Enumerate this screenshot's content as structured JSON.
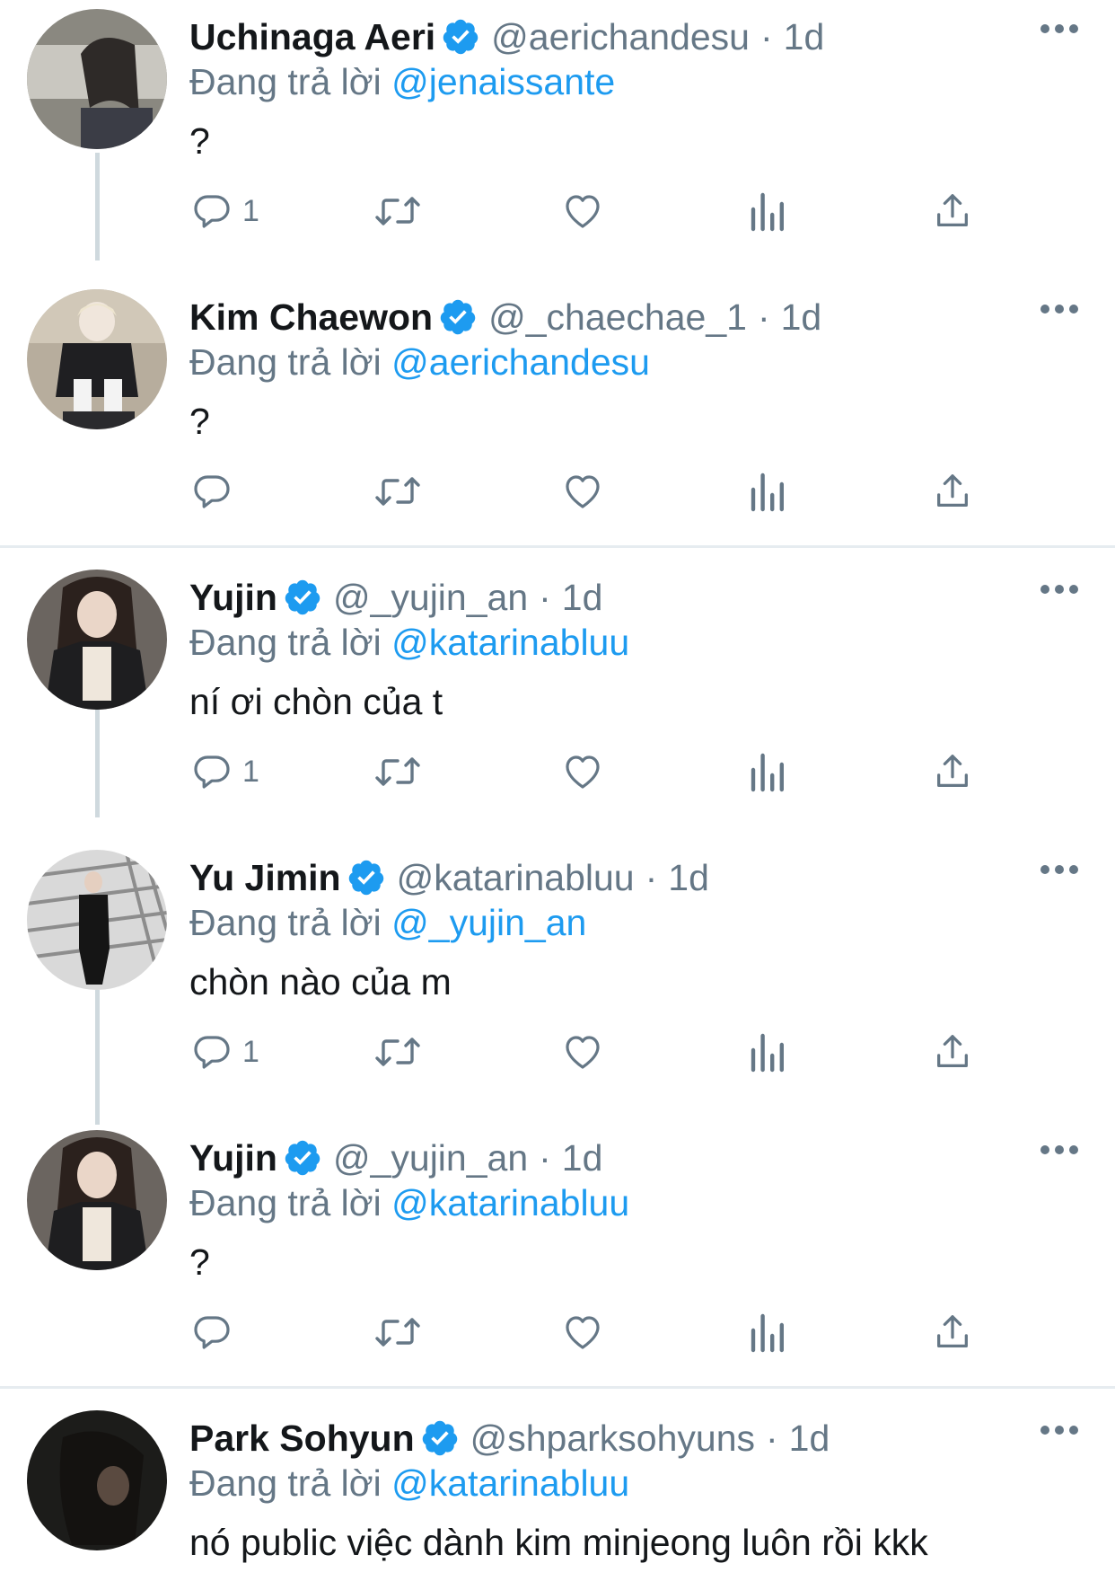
{
  "reply_prefix": "Đang trả lời",
  "colors": {
    "accent": "#1d9bf0",
    "muted": "#657786",
    "text": "#14171a",
    "divider": "#e6ecf0",
    "thread": "#cfd9de"
  },
  "icons": {
    "reply": "reply-bubble-icon",
    "retweet": "retweet-icon",
    "like": "heart-icon",
    "analytics": "analytics-icon",
    "share": "share-icon",
    "more": "more-options-icon",
    "verified": "verified-badge-icon"
  },
  "tweets": [
    {
      "name": "Uchinaga Aeri",
      "handle": "@aerichandesu",
      "sep": "·",
      "time": "1d",
      "reply_to": "@jenaissante",
      "text": "?",
      "reply_count": "1"
    },
    {
      "name": "Kim Chaewon",
      "handle": "@_chaechae_1",
      "sep": "·",
      "time": "1d",
      "reply_to": "@aerichandesu",
      "text": "?",
      "reply_count": ""
    },
    {
      "name": "Yujin",
      "handle": "@_yujin_an",
      "sep": "·",
      "time": "1d",
      "reply_to": "@katarinabluu",
      "text": "ní ơi chòn của t",
      "reply_count": "1"
    },
    {
      "name": "Yu Jimin",
      "handle": "@katarinabluu",
      "sep": "·",
      "time": "1d",
      "reply_to": "@_yujin_an",
      "text": "chòn nào của m",
      "reply_count": "1"
    },
    {
      "name": "Yujin",
      "handle": "@_yujin_an",
      "sep": "·",
      "time": "1d",
      "reply_to": "@katarinabluu",
      "text": "?",
      "reply_count": ""
    },
    {
      "name": "Park Sohyun",
      "handle": "@shparksohyuns",
      "sep": "·",
      "time": "1d",
      "reply_to": "@katarinabluu",
      "text": "nó public việc dành kim minjeong luôn rồi kkk",
      "reply_count": ""
    }
  ]
}
